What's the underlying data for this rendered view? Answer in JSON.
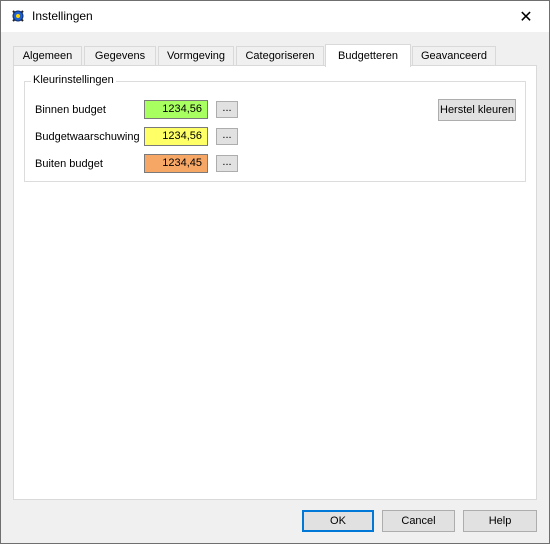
{
  "window": {
    "title": "Instellingen",
    "close_glyph": "✕",
    "icon": "app-icon"
  },
  "tabs": [
    {
      "label": "Algemeen"
    },
    {
      "label": "Gegevens"
    },
    {
      "label": "Vormgeving"
    },
    {
      "label": "Categoriseren"
    },
    {
      "label": "Budgetteren"
    },
    {
      "label": "Geavanceerd"
    }
  ],
  "active_tab": "Budgetteren",
  "group": {
    "title": "Kleurinstellingen",
    "rows": [
      {
        "label": "Binnen budget",
        "value": "1234,56",
        "color": "#a8ff60",
        "button": "..."
      },
      {
        "label": "Budgetwaarschuwing",
        "value": "1234,56",
        "color": "#ffff66",
        "button": "..."
      },
      {
        "label": "Buiten budget",
        "value": "1234,45",
        "color": "#f7a765",
        "button": "..."
      }
    ],
    "reset_button": "Herstel kleuren"
  },
  "footer": {
    "ok": "OK",
    "cancel": "Cancel",
    "help": "Help"
  }
}
